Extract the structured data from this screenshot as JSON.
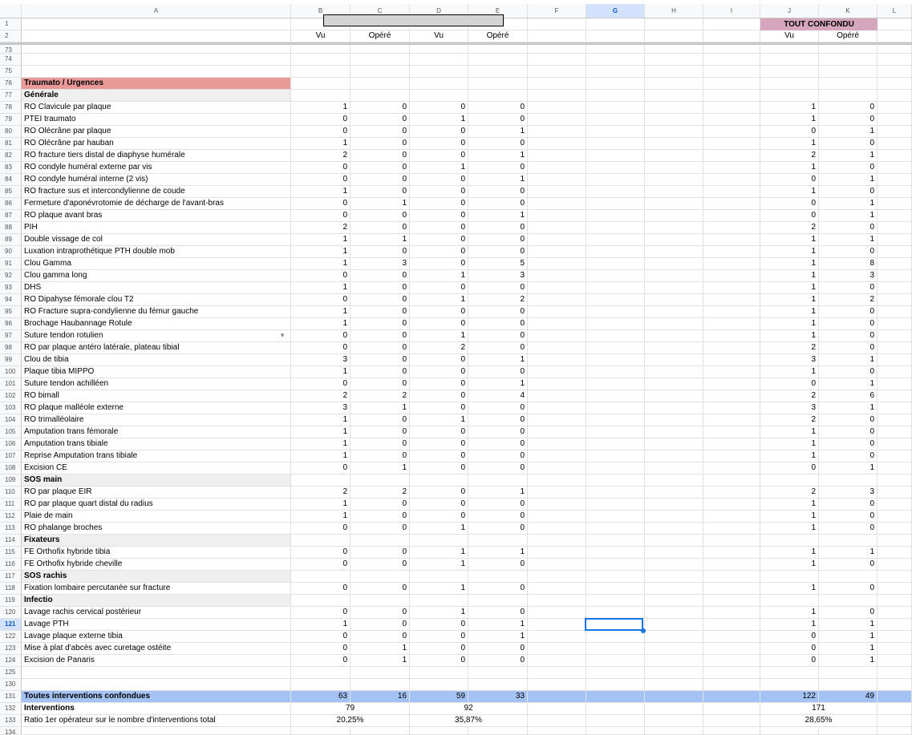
{
  "columns": [
    "A",
    "B",
    "C",
    "D",
    "E",
    "F",
    "G",
    "H",
    "I",
    "J",
    "K",
    "L"
  ],
  "selected_column": "G",
  "selected_row": "121",
  "header": {
    "group_right": "TOUT CONFONDU",
    "sub": [
      "Vu",
      "Opéré",
      "Vu",
      "Opéré",
      "Vu",
      "Opéré"
    ]
  },
  "rows": [
    {
      "n": "73",
      "t": "empty"
    },
    {
      "n": "74",
      "t": "empty"
    },
    {
      "n": "75",
      "t": "empty"
    },
    {
      "n": "76",
      "t": "sec",
      "label": "Traumato / Urgences"
    },
    {
      "n": "77",
      "t": "sub",
      "label": "Générale"
    },
    {
      "n": "78",
      "label": "RO Clavicule par plaque",
      "v": [
        1,
        0,
        0,
        0,
        1,
        0
      ]
    },
    {
      "n": "79",
      "label": "PTEI traumato",
      "v": [
        0,
        0,
        1,
        0,
        1,
        0
      ]
    },
    {
      "n": "80",
      "label": "RO Olécrâne par plaque",
      "v": [
        0,
        0,
        0,
        1,
        0,
        1
      ]
    },
    {
      "n": "81",
      "label": "RO Olécrâne par hauban",
      "v": [
        1,
        0,
        0,
        0,
        1,
        0
      ]
    },
    {
      "n": "82",
      "label": "RO fracture tiers distal de diaphyse humérale",
      "v": [
        2,
        0,
        0,
        1,
        2,
        1
      ]
    },
    {
      "n": "83",
      "label": "RO condyle huméral externe par vis",
      "v": [
        0,
        0,
        1,
        0,
        1,
        0
      ]
    },
    {
      "n": "84",
      "label": "RO condyle huméral interne (2 vis)",
      "v": [
        0,
        0,
        0,
        1,
        0,
        1
      ]
    },
    {
      "n": "85",
      "label": "RO fracture sus et intercondylienne de coude",
      "v": [
        1,
        0,
        0,
        0,
        1,
        0
      ]
    },
    {
      "n": "86",
      "label": "Fermeture d'aponévrotomie de décharge de l'avant-bras",
      "v": [
        0,
        1,
        0,
        0,
        0,
        1
      ]
    },
    {
      "n": "87",
      "label": "RO plaque avant bras",
      "v": [
        0,
        0,
        0,
        1,
        0,
        1
      ]
    },
    {
      "n": "88",
      "label": "PIH",
      "v": [
        2,
        0,
        0,
        0,
        2,
        0
      ]
    },
    {
      "n": "89",
      "label": "Double vissage de col",
      "v": [
        1,
        1,
        0,
        0,
        1,
        1
      ]
    },
    {
      "n": "90",
      "label": "Luxation intraprothétique PTH double mob",
      "v": [
        1,
        0,
        0,
        0,
        1,
        0
      ]
    },
    {
      "n": "91",
      "label": "Clou Gamma",
      "v": [
        1,
        3,
        0,
        5,
        1,
        8
      ]
    },
    {
      "n": "92",
      "label": "Clou gamma long",
      "v": [
        0,
        0,
        1,
        3,
        1,
        3
      ]
    },
    {
      "n": "93",
      "label": "DHS",
      "v": [
        1,
        0,
        0,
        0,
        1,
        0
      ]
    },
    {
      "n": "94",
      "label": "RO Dipahyse fémorale clou T2",
      "v": [
        0,
        0,
        1,
        2,
        1,
        2
      ]
    },
    {
      "n": "95",
      "label": "RO Fracture supra-condylienne du fémur gauche",
      "v": [
        1,
        0,
        0,
        0,
        1,
        0
      ]
    },
    {
      "n": "96",
      "label": "Brochage Haubannage Rotule",
      "v": [
        1,
        0,
        0,
        0,
        1,
        0
      ]
    },
    {
      "n": "97",
      "label": "Suture tendon rotulien",
      "v": [
        0,
        0,
        1,
        0,
        1,
        0
      ],
      "dd": true
    },
    {
      "n": "98",
      "label": "RO par plaque antéro latérale, plateau tibial",
      "v": [
        0,
        0,
        2,
        0,
        2,
        0
      ]
    },
    {
      "n": "99",
      "label": "Clou de tibia",
      "v": [
        3,
        0,
        0,
        1,
        3,
        1
      ]
    },
    {
      "n": "100",
      "label": "Plaque tibia MIPPO",
      "v": [
        1,
        0,
        0,
        0,
        1,
        0
      ]
    },
    {
      "n": "101",
      "label": "Suture tendon achilléen",
      "v": [
        0,
        0,
        0,
        1,
        0,
        1
      ]
    },
    {
      "n": "102",
      "label": "RO bimall",
      "v": [
        2,
        2,
        0,
        4,
        2,
        6
      ]
    },
    {
      "n": "103",
      "label": "RO plaque malléole externe",
      "v": [
        3,
        1,
        0,
        0,
        3,
        1
      ]
    },
    {
      "n": "104",
      "label": "RO trimalléolaire",
      "v": [
        1,
        0,
        1,
        0,
        2,
        0
      ]
    },
    {
      "n": "105",
      "label": "Amputation trans fémorale",
      "v": [
        1,
        0,
        0,
        0,
        1,
        0
      ]
    },
    {
      "n": "106",
      "label": "Amputation trans tibiale",
      "v": [
        1,
        0,
        0,
        0,
        1,
        0
      ]
    },
    {
      "n": "107",
      "label": "Reprise Amputation trans tibiale",
      "v": [
        1,
        0,
        0,
        0,
        1,
        0
      ]
    },
    {
      "n": "108",
      "label": "Excision CE",
      "v": [
        0,
        1,
        0,
        0,
        0,
        1
      ]
    },
    {
      "n": "109",
      "t": "sub",
      "label": "SOS main"
    },
    {
      "n": "110",
      "label": "RO par plaque EIR",
      "v": [
        2,
        2,
        0,
        1,
        2,
        3
      ]
    },
    {
      "n": "111",
      "label": "RO par plaque quart distal du radius",
      "v": [
        1,
        0,
        0,
        0,
        1,
        0
      ]
    },
    {
      "n": "112",
      "label": "Plaie de main",
      "v": [
        1,
        0,
        0,
        0,
        1,
        0
      ]
    },
    {
      "n": "113",
      "label": "RO phalange broches",
      "v": [
        0,
        0,
        1,
        0,
        1,
        0
      ]
    },
    {
      "n": "114",
      "t": "sub",
      "label": "Fixateurs"
    },
    {
      "n": "115",
      "label": "FE Orthofix hybride tibia",
      "v": [
        0,
        0,
        1,
        1,
        1,
        1
      ]
    },
    {
      "n": "116",
      "label": "FE Orthofix hybride cheville",
      "v": [
        0,
        0,
        1,
        0,
        1,
        0
      ]
    },
    {
      "n": "117",
      "t": "sub",
      "label": "SOS rachis"
    },
    {
      "n": "118",
      "label": "Fixation lombaire percutanée sur fracture",
      "v": [
        0,
        0,
        1,
        0,
        1,
        0
      ]
    },
    {
      "n": "119",
      "t": "sub",
      "label": "Infectio"
    },
    {
      "n": "120",
      "label": "Lavage rachis cervical postérieur",
      "v": [
        0,
        0,
        1,
        0,
        1,
        0
      ]
    },
    {
      "n": "121",
      "label": "Lavage PTH",
      "v": [
        1,
        0,
        0,
        1,
        1,
        1
      ]
    },
    {
      "n": "122",
      "label": "Lavage plaque externe tibia",
      "v": [
        0,
        0,
        0,
        1,
        0,
        1
      ]
    },
    {
      "n": "123",
      "label": "Mise à plat d'abcès avec curetage ostéite",
      "v": [
        0,
        1,
        0,
        0,
        0,
        1
      ]
    },
    {
      "n": "124",
      "label": "Excision de Panaris",
      "v": [
        0,
        1,
        0,
        0,
        0,
        1
      ]
    },
    {
      "n": "125",
      "t": "empty"
    },
    {
      "n": "130",
      "t": "empty"
    },
    {
      "n": "131",
      "t": "tot",
      "label": "Toutes interventions confondues",
      "v": [
        63,
        16,
        59,
        33,
        122,
        49
      ]
    },
    {
      "n": "132",
      "t": "merged",
      "label": "Interventions",
      "m": [
        "79",
        "92",
        "171"
      ]
    },
    {
      "n": "133",
      "t": "ratio",
      "label": "Ratio 1er opérateur sur le nombre d'interventions total",
      "m": [
        "20,25%",
        "35,87%",
        "28,65%"
      ]
    },
    {
      "n": "134",
      "t": "empty"
    }
  ]
}
